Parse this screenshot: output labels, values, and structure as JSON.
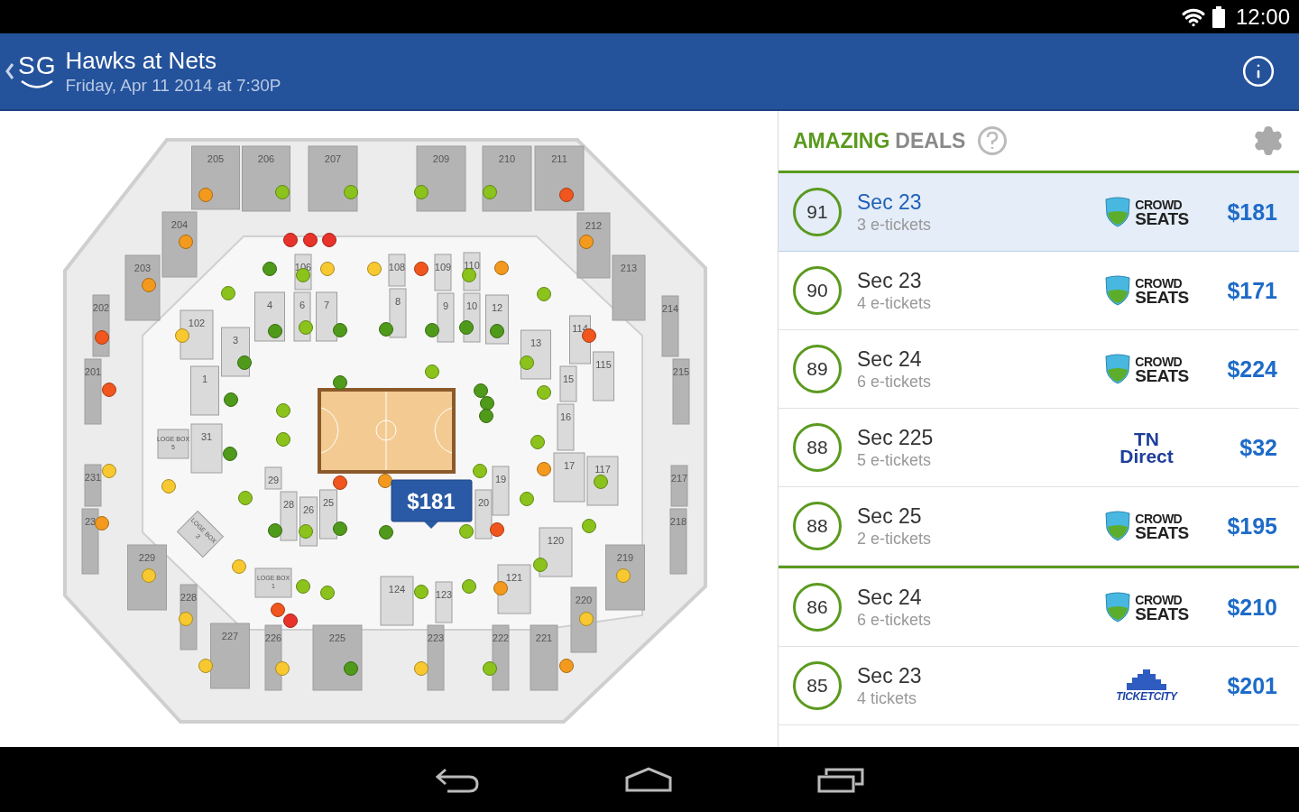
{
  "status_bar": {
    "time": "12:00"
  },
  "app_bar": {
    "logo": "SG",
    "title": "Hawks at Nets",
    "subtitle": "Friday, Apr 11 2014 at 7:30P"
  },
  "seat_map": {
    "sections": [
      {
        "label": "205",
        "kind": "upper"
      },
      {
        "label": "206",
        "kind": "upper"
      },
      {
        "label": "207",
        "kind": "upper"
      },
      {
        "label": "209",
        "kind": "upper"
      },
      {
        "label": "210",
        "kind": "upper"
      },
      {
        "label": "211",
        "kind": "upper"
      },
      {
        "label": "204",
        "kind": "upper"
      },
      {
        "label": "212",
        "kind": "upper"
      },
      {
        "label": "203",
        "kind": "upper"
      },
      {
        "label": "213",
        "kind": "upper"
      },
      {
        "label": "202",
        "kind": "upper"
      },
      {
        "label": "214",
        "kind": "upper"
      },
      {
        "label": "201",
        "kind": "upper"
      },
      {
        "label": "215",
        "kind": "upper"
      },
      {
        "label": "231",
        "kind": "upper"
      },
      {
        "label": "217",
        "kind": "upper"
      },
      {
        "label": "23",
        "kind": "upper"
      },
      {
        "label": "218",
        "kind": "upper"
      },
      {
        "label": "229",
        "kind": "upper"
      },
      {
        "label": "219",
        "kind": "upper"
      },
      {
        "label": "228",
        "kind": "upper"
      },
      {
        "label": "220",
        "kind": "upper"
      },
      {
        "label": "227",
        "kind": "upper"
      },
      {
        "label": "226",
        "kind": "upper"
      },
      {
        "label": "225",
        "kind": "upper"
      },
      {
        "label": "223",
        "kind": "upper"
      },
      {
        "label": "222",
        "kind": "upper"
      },
      {
        "label": "221",
        "kind": "upper"
      },
      {
        "label": "106",
        "kind": "lower"
      },
      {
        "label": "108",
        "kind": "lower"
      },
      {
        "label": "109",
        "kind": "lower"
      },
      {
        "label": "110",
        "kind": "lower"
      },
      {
        "label": "4",
        "kind": "lower"
      },
      {
        "label": "6",
        "kind": "lower"
      },
      {
        "label": "7",
        "kind": "lower"
      },
      {
        "label": "8",
        "kind": "lower"
      },
      {
        "label": "9",
        "kind": "lower"
      },
      {
        "label": "10",
        "kind": "lower"
      },
      {
        "label": "12",
        "kind": "lower"
      },
      {
        "label": "13",
        "kind": "lower"
      },
      {
        "label": "3",
        "kind": "lower"
      },
      {
        "label": "102",
        "kind": "lower"
      },
      {
        "label": "114",
        "kind": "lower"
      },
      {
        "label": "115",
        "kind": "lower"
      },
      {
        "label": "1",
        "kind": "lower"
      },
      {
        "label": "15",
        "kind": "lower"
      },
      {
        "label": "16",
        "kind": "lower"
      },
      {
        "label": "31",
        "kind": "lower"
      },
      {
        "label": "17",
        "kind": "lower"
      },
      {
        "label": "117",
        "kind": "lower"
      },
      {
        "label": "29",
        "kind": "lower"
      },
      {
        "label": "19",
        "kind": "lower"
      },
      {
        "label": "28",
        "kind": "lower"
      },
      {
        "label": "26",
        "kind": "lower"
      },
      {
        "label": "25",
        "kind": "lower"
      },
      {
        "label": "20",
        "kind": "lower"
      },
      {
        "label": "120",
        "kind": "lower"
      },
      {
        "label": "121",
        "kind": "lower"
      },
      {
        "label": "124",
        "kind": "lower"
      },
      {
        "label": "123",
        "kind": "lower"
      },
      {
        "label": "LOGE BOX 5",
        "kind": "loge"
      },
      {
        "label": "LOGE BOX 1",
        "kind": "loge"
      },
      {
        "label": "LOGE BOX 3",
        "kind": "loge"
      }
    ],
    "markers": [
      {
        "color": "#f39a1e"
      },
      {
        "color": "#8bc31c"
      },
      {
        "color": "#8bc31c"
      },
      {
        "color": "#8bc31c"
      },
      {
        "color": "#8bc31c"
      },
      {
        "color": "#f0561e"
      },
      {
        "color": "#f39a1e"
      },
      {
        "color": "#f39a1e"
      },
      {
        "color": "#f39a1e"
      },
      {
        "color": "#f0561e"
      },
      {
        "color": "#f0561e"
      },
      {
        "color": "#f7c830"
      },
      {
        "color": "#f39a1e"
      },
      {
        "color": "#f7c830"
      },
      {
        "color": "#f7c830"
      },
      {
        "color": "#f7c830"
      },
      {
        "color": "#f7c830"
      },
      {
        "color": "#4f9a1a"
      },
      {
        "color": "#f7c830"
      },
      {
        "color": "#8bc31c"
      },
      {
        "color": "#f39a1e"
      },
      {
        "color": "#f7c830"
      },
      {
        "color": "#f7c830"
      },
      {
        "color": "#e8332a"
      },
      {
        "color": "#e8332a"
      },
      {
        "color": "#e8332a"
      },
      {
        "color": "#4f9a1a"
      },
      {
        "color": "#8bc31c"
      },
      {
        "color": "#f7c830"
      },
      {
        "color": "#f7c830"
      },
      {
        "color": "#f0561e"
      },
      {
        "color": "#8bc31c"
      },
      {
        "color": "#f39a1e"
      },
      {
        "color": "#8bc31c"
      },
      {
        "color": "#f7c830"
      },
      {
        "color": "#8bc31c"
      },
      {
        "color": "#f0561e"
      },
      {
        "color": "#4f9a1a"
      },
      {
        "color": "#8bc31c"
      },
      {
        "color": "#4f9a1a"
      },
      {
        "color": "#4f9a1a"
      },
      {
        "color": "#4f9a1a"
      },
      {
        "color": "#4f9a1a"
      },
      {
        "color": "#4f9a1a"
      },
      {
        "color": "#4f9a1a"
      },
      {
        "color": "#8bc31c"
      },
      {
        "color": "#4f9a1a"
      },
      {
        "color": "#8bc31c"
      },
      {
        "color": "#4f9a1a"
      },
      {
        "color": "#8bc31c"
      },
      {
        "color": "#8bc31c"
      },
      {
        "color": "#4f9a1a"
      },
      {
        "color": "#4f9a1a"
      },
      {
        "color": "#4f9a1a"
      },
      {
        "color": "#8bc31c"
      },
      {
        "color": "#4f9a1a"
      },
      {
        "color": "#8bc31c"
      },
      {
        "color": "#8bc31c"
      },
      {
        "color": "#f39a1e"
      },
      {
        "color": "#8bc31c"
      },
      {
        "color": "#f7c830"
      },
      {
        "color": "#f0561e"
      },
      {
        "color": "#f39a1e"
      },
      {
        "color": "#8bc31c"
      },
      {
        "color": "#8bc31c"
      },
      {
        "color": "#4f9a1a"
      },
      {
        "color": "#8bc31c"
      },
      {
        "color": "#4f9a1a"
      },
      {
        "color": "#4f9a1a"
      },
      {
        "color": "#8bc31c"
      },
      {
        "color": "#f0561e"
      },
      {
        "color": "#8bc31c"
      },
      {
        "color": "#f7c830"
      },
      {
        "color": "#8bc31c"
      },
      {
        "color": "#8bc31c"
      },
      {
        "color": "#8bc31c"
      },
      {
        "color": "#8bc31c"
      },
      {
        "color": "#8bc31c"
      },
      {
        "color": "#f39a1e"
      },
      {
        "color": "#f0561e"
      },
      {
        "color": "#e8332a"
      }
    ],
    "callout": {
      "price": "$181"
    }
  },
  "deals_panel": {
    "title_highlight": "AMAZING",
    "title_rest": "DEALS",
    "deals": [
      {
        "score": "91",
        "section": "Sec 23",
        "tickets": "3 e-tickets",
        "vendor": {
          "kind": "crowdseats",
          "line1": "CROWD",
          "line2": "SEATS"
        },
        "price": "$181",
        "selected": true
      },
      {
        "score": "90",
        "section": "Sec 23",
        "tickets": "4 e-tickets",
        "vendor": {
          "kind": "crowdseats",
          "line1": "CROWD",
          "line2": "SEATS"
        },
        "price": "$171",
        "selected": false
      },
      {
        "score": "89",
        "section": "Sec 24",
        "tickets": "6 e-tickets",
        "vendor": {
          "kind": "crowdseats",
          "line1": "CROWD",
          "line2": "SEATS"
        },
        "price": "$224",
        "selected": false
      },
      {
        "score": "88",
        "section": "Sec 225",
        "tickets": "5 e-tickets",
        "vendor": {
          "kind": "wordmark",
          "line1": "TN",
          "line2": "Direct"
        },
        "price": "$32",
        "selected": false
      },
      {
        "score": "88",
        "section": "Sec 25",
        "tickets": "2 e-tickets",
        "vendor": {
          "kind": "crowdseats",
          "line1": "CROWD",
          "line2": "SEATS"
        },
        "price": "$195",
        "selected": false
      }
    ],
    "others": [
      {
        "score": "86",
        "section": "Sec 24",
        "tickets": "6 e-tickets",
        "vendor": {
          "kind": "crowdseats",
          "line1": "CROWD",
          "line2": "SEATS"
        },
        "price": "$210",
        "selected": false
      },
      {
        "score": "85",
        "section": "Sec 23",
        "tickets": "4 tickets",
        "vendor": {
          "kind": "ticketcity",
          "line1": "TICKETCITY"
        },
        "price": "$201",
        "selected": false
      }
    ]
  }
}
